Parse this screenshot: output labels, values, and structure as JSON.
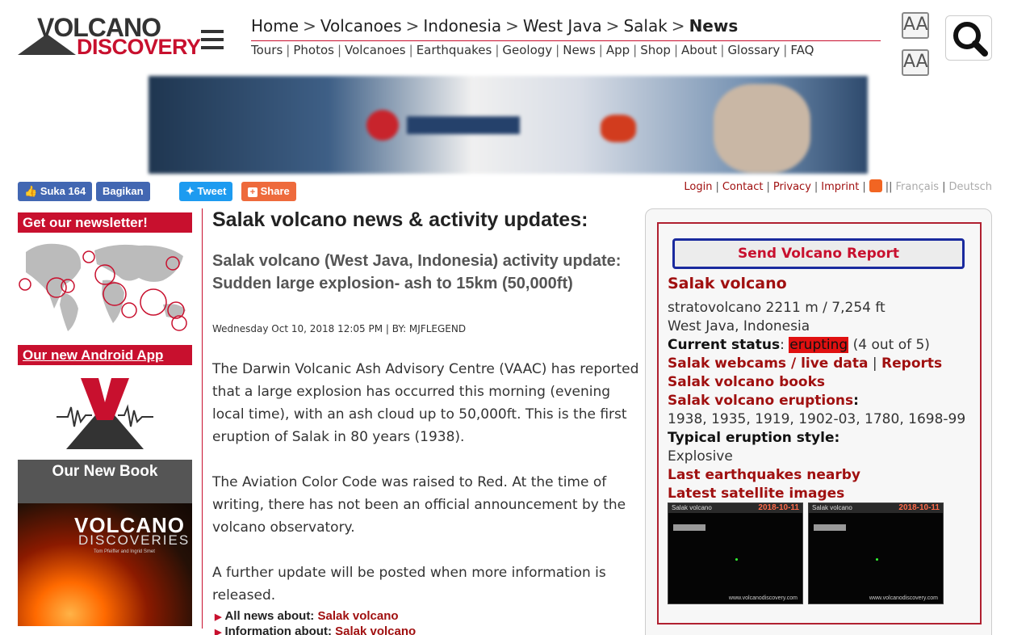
{
  "logo": {
    "line1": "VOLCANO",
    "line2": "DISCOVERY"
  },
  "breadcrumb": [
    {
      "label": "Home"
    },
    {
      "label": "Volcanoes"
    },
    {
      "label": "Indonesia"
    },
    {
      "label": "West Java"
    },
    {
      "label": "Salak"
    },
    {
      "label": "News"
    }
  ],
  "breadcrumb_separator": ">",
  "topnav": [
    "Tours",
    "Photos",
    "Volcanoes",
    "Earthquakes",
    "Geology",
    "News",
    "App",
    "Shop",
    "About",
    "Glossary",
    "FAQ"
  ],
  "topnav_separator": "|",
  "font_controls": {
    "increase": "AA",
    "decrease": "AA"
  },
  "social": {
    "like_label": "Suka 164",
    "share_fb_label": "Bagikan",
    "tweet_label": "Tweet",
    "share_label": "Share"
  },
  "utility_links": {
    "login": "Login",
    "contact": "Contact",
    "privacy": "Privacy",
    "imprint": "Imprint",
    "lang_fr": "Français",
    "lang_de": "Deutsch",
    "pipe": "|",
    "double_pipe": "||"
  },
  "sidebar": {
    "newsletter_heading": "Get our newsletter!",
    "app_heading": "Our new Android App",
    "book_heading": "Our New Book",
    "book_title_1": "VOLCANO",
    "book_title_2": "DISCOVERIES",
    "book_authors": "Tom Pfeiffer and Ingrid Smet"
  },
  "article": {
    "page_title": "Salak volcano news & activity updates:",
    "post_title": "Salak volcano (West Java, Indonesia) activity update: Sudden large explosion- ash to 15km (50,000ft)",
    "meta": "Wednesday Oct 10, 2018 12:05 PM | BY: MJFLEGEND",
    "paragraphs": [
      "The Darwin Volcanic Ash Advisory Centre (VAAC) has reported that a large explosion has occurred this morning (evening local time), with an ash cloud up to 50,000ft. This is the first eruption of Salak in 80 years (1938).",
      "The Aviation Color Code was raised to Red. At the time of writing, there has not been an official announcement by the volcano observatory.",
      "A further update will be posted when more information is released."
    ],
    "more_news_label": "All news about:",
    "more_news_link": "Salak volcano",
    "more_info_label": "Information about:",
    "more_info_link": "Salak volcano"
  },
  "volcano_box": {
    "report_button": "Send Volcano Report",
    "name_link": "Salak volcano",
    "type_elev": "stratovolcano 2211 m / 7,254 ft",
    "location": "West Java, Indonesia",
    "status_label": "Current status",
    "status_value": "erupting",
    "status_scale": "(4 out of 5)",
    "webcams_link": "Salak webcams / live data",
    "reports_link": "Reports",
    "books_link": "Salak volcano books",
    "eruptions_link": "Salak volcano eruptions",
    "eruption_years": "1938, 1935, 1919, 1902-03, 1780, 1698-99",
    "style_label": "Typical eruption style:",
    "style_value": "Explosive",
    "earthquakes_link": "Last earthquakes nearby",
    "satellite_link": "Latest satellite images",
    "sat_images": [
      {
        "name": "Salak volcano",
        "date": "2018-10-11",
        "credit": "www.volcanodiscovery.com"
      },
      {
        "name": "Salak volcano",
        "date": "2018-10-11",
        "credit": "www.volcanodiscovery.com"
      }
    ]
  },
  "colors": {
    "brand_red": "#c8102e",
    "link_red": "#a01010",
    "report_border": "#1a2a9e",
    "status_red": "#e01010"
  }
}
